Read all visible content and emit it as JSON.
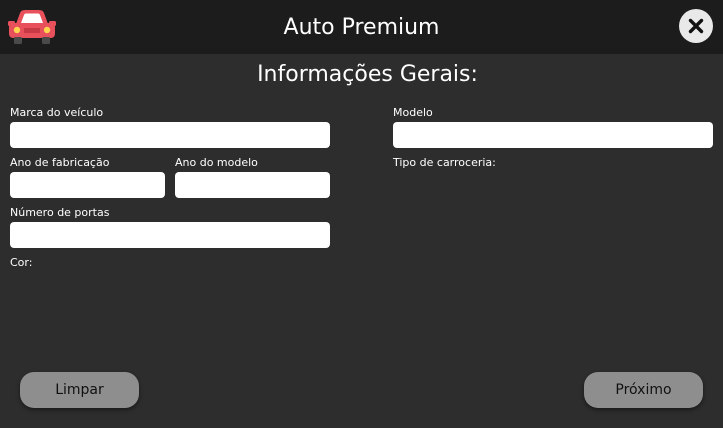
{
  "header": {
    "title": "Auto Premium",
    "logo_icon": "car-icon",
    "close_icon": "close-icon"
  },
  "form": {
    "section_title": "Informações Gerais:",
    "fields": {
      "marca": {
        "label": "Marca do veículo",
        "value": "",
        "placeholder": ""
      },
      "modelo": {
        "label": "Modelo",
        "value": "",
        "placeholder": ""
      },
      "ano_fabricacao": {
        "label": "Ano de fabricação",
        "value": "",
        "placeholder": ""
      },
      "ano_modelo": {
        "label": "Ano do modelo",
        "value": "",
        "placeholder": ""
      },
      "tipo_carroceria": {
        "label": "Tipo de carroceria:"
      },
      "numero_portas": {
        "label": "Número de portas",
        "value": "",
        "placeholder": ""
      },
      "cor": {
        "label": "Cor:"
      }
    }
  },
  "footer": {
    "clear_label": "Limpar",
    "next_label": "Próximo"
  },
  "colors": {
    "background": "#2d2d2d",
    "header_background": "#1c1c1c",
    "button_background": "#8e8e8e",
    "input_background": "#ffffff",
    "close_button_background": "#e9e9e9",
    "car_body": "#e8505b"
  }
}
